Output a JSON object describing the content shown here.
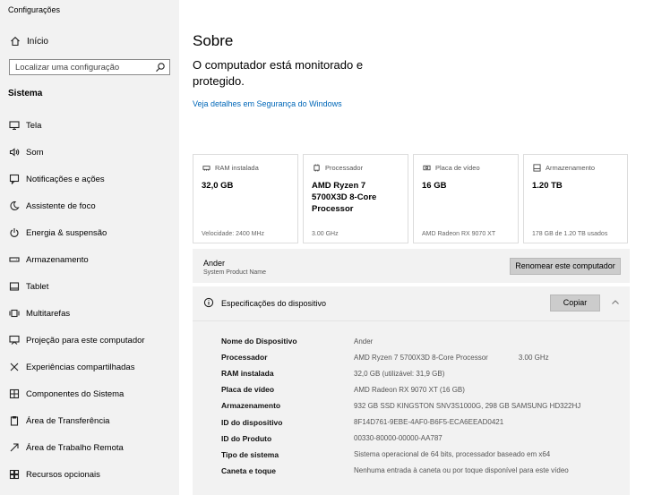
{
  "window": {
    "title": "Configurações"
  },
  "sidebar": {
    "home_label": "Início",
    "search_placeholder": "Localizar uma configuração",
    "section_title": "Sistema",
    "items": [
      {
        "label": "Tela",
        "icon": "monitor-icon"
      },
      {
        "label": "Som",
        "icon": "speaker-icon"
      },
      {
        "label": "Notificações e ações",
        "icon": "notification-icon"
      },
      {
        "label": "Assistente de foco",
        "icon": "moon-icon"
      },
      {
        "label": "Energia & suspensão",
        "icon": "power-icon"
      },
      {
        "label": "Armazenamento",
        "icon": "storage-icon"
      },
      {
        "label": "Tablet",
        "icon": "tablet-icon"
      },
      {
        "label": "Multitarefas",
        "icon": "multitask-icon"
      },
      {
        "label": "Projeção para este computador",
        "icon": "projection-icon"
      },
      {
        "label": "Experiências compartilhadas",
        "icon": "shared-icon"
      },
      {
        "label": "Componentes do Sistema",
        "icon": "components-icon"
      },
      {
        "label": "Área de Transferência",
        "icon": "clipboard-icon"
      },
      {
        "label": "Área de Trabalho Remota",
        "icon": "remote-icon"
      },
      {
        "label": "Recursos opcionais",
        "icon": "features-icon"
      }
    ]
  },
  "main": {
    "title": "Sobre",
    "protection_text": "O computador está monitorado e protegido.",
    "security_link": "Veja detalhes em Segurança do Windows",
    "cards": [
      {
        "label": "RAM instalada",
        "value": "32,0 GB",
        "sub": "Velocidade: 2400 MHz",
        "icon": "ram-icon"
      },
      {
        "label": "Processador",
        "value": "AMD Ryzen 7 5700X3D 8-Core Processor",
        "sub": "3.00 GHz",
        "icon": "processor-icon"
      },
      {
        "label": "Placa de vídeo",
        "value": "16 GB",
        "sub": "AMD Radeon RX 9070 XT",
        "icon": "gpu-icon"
      },
      {
        "label": "Armazenamento",
        "value": "1.20 TB",
        "sub": "178 GB de 1.20 TB usados",
        "icon": "storage-icon"
      }
    ],
    "pc_name": "Ander",
    "pc_model": "System Product Name",
    "rename_button": "Renomear este computador",
    "specs": {
      "title": "Especificações do dispositivo",
      "copy_button": "Copiar",
      "rows": [
        {
          "key": "Nome do Dispositivo",
          "value": "Ander",
          "extra": ""
        },
        {
          "key": "Processador",
          "value": "AMD Ryzen 7 5700X3D 8-Core Processor",
          "extra": "3.00 GHz"
        },
        {
          "key": "RAM instalada",
          "value": "32,0 GB (utilizável: 31,9 GB)",
          "extra": ""
        },
        {
          "key": "Placa de vídeo",
          "value": "AMD Radeon RX 9070 XT (16 GB)",
          "extra": ""
        },
        {
          "key": "Armazenamento",
          "value": "932 GB SSD KINGSTON SNV3S1000G, 298 GB SAMSUNG HD322HJ",
          "extra": ""
        },
        {
          "key": "ID do dispositivo",
          "value": "8F14D761-9EBE-4AF0-B6F5-ECA6EEAD0421",
          "extra": ""
        },
        {
          "key": "ID do Produto",
          "value": "00330-80000-00000-AA787",
          "extra": ""
        },
        {
          "key": "Tipo de sistema",
          "value": "Sistema operacional de 64 bits, processador baseado em x64",
          "extra": ""
        },
        {
          "key": "Caneta e toque",
          "value": "Nenhuma entrada à caneta ou por toque disponível para este vídeo",
          "extra": ""
        }
      ]
    }
  }
}
